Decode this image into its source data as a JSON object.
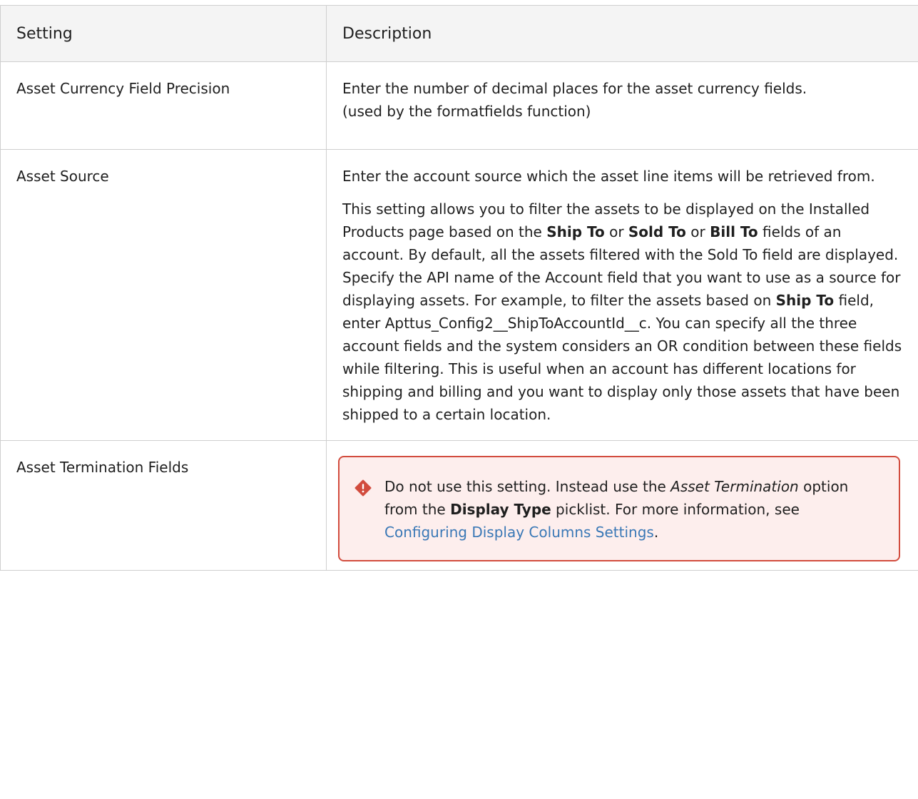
{
  "headers": {
    "setting": "Setting",
    "description": "Description"
  },
  "rows": [
    {
      "setting": "Asset Currency Field Precision",
      "line1": "Enter the number of decimal places for the asset currency fields.",
      "line2": "(used by the formatfields function)"
    },
    {
      "setting": "Asset Source",
      "p1": "Enter the account source which the asset line items will be retrieved from.",
      "p2_a": "This setting allows you to filter the assets to be displayed on the Installed Products page based on the ",
      "p2_b1": "Ship To",
      "p2_c": " or ",
      "p2_b2": "Sold To",
      "p2_d": " or ",
      "p2_b3": "Bill To",
      "p2_e": " fields of an account. By default, all the assets filtered with the Sold To field are displayed. Specify the API name of the Account field that you want to use as a source for displaying assets. For example, to filter the assets based on ",
      "p2_b4": "Ship To",
      "p2_f": " field, enter Apttus_Config2__ShipToAccountId__c. You can specify all the three account fields and the system considers an OR condition between these fields while filtering. This is useful when an account has different locations for shipping and billing and you want to display only those assets that have been shipped to a certain location."
    },
    {
      "setting": "Asset Termination Fields",
      "warning": {
        "icon": "warning-diamond-icon",
        "color": "#d24c3e",
        "t1": "Do not use this setting. Instead use the ",
        "i1": "Asset Termination",
        "t2": " option from the ",
        "b1": "Display Type",
        "t3": " picklist. For more information, see ",
        "link": "Configuring Display Columns Settings",
        "t4": "."
      }
    }
  ]
}
